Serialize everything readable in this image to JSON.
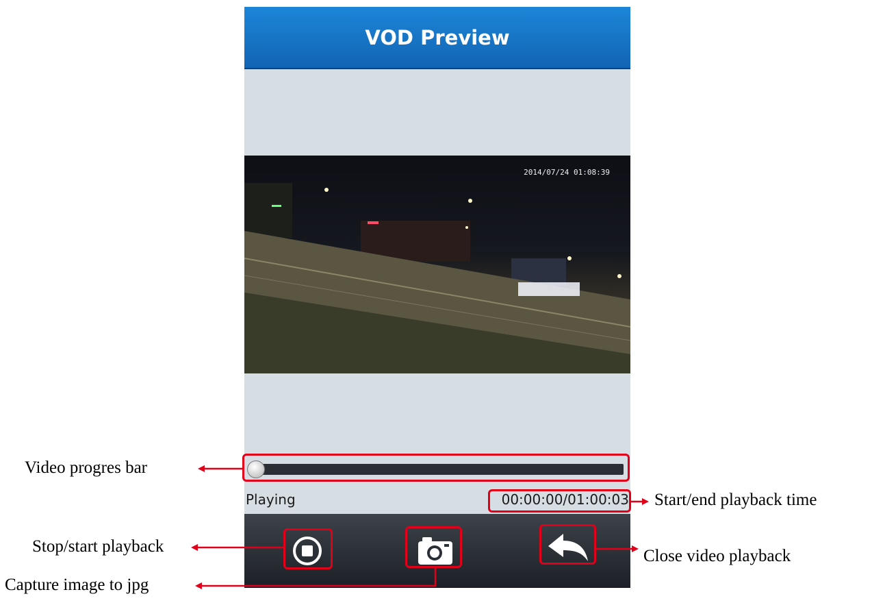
{
  "app": {
    "title": "VOD Preview"
  },
  "video": {
    "timestamp": "2014/07/24 01:08:39"
  },
  "playback": {
    "status": "Playing",
    "time": "00:00:00/01:00:03",
    "progress_fraction": 0.0
  },
  "toolbar": {
    "buttons": [
      {
        "name": "stop-start-button",
        "icon": "stop-circle-icon"
      },
      {
        "name": "capture-button",
        "icon": "camera-icon"
      },
      {
        "name": "close-button",
        "icon": "back-arrow-icon"
      }
    ]
  },
  "annotations": {
    "progress_bar": "Video progres bar",
    "playback_time": "Start/end playback time",
    "stop_start": "Stop/start playback",
    "capture": "Capture image to jpg",
    "close": "Close video playback"
  },
  "colors": {
    "title_bar": "#1a78c8",
    "annotation": "#e0001a",
    "toolbar": "#2a2f35"
  }
}
